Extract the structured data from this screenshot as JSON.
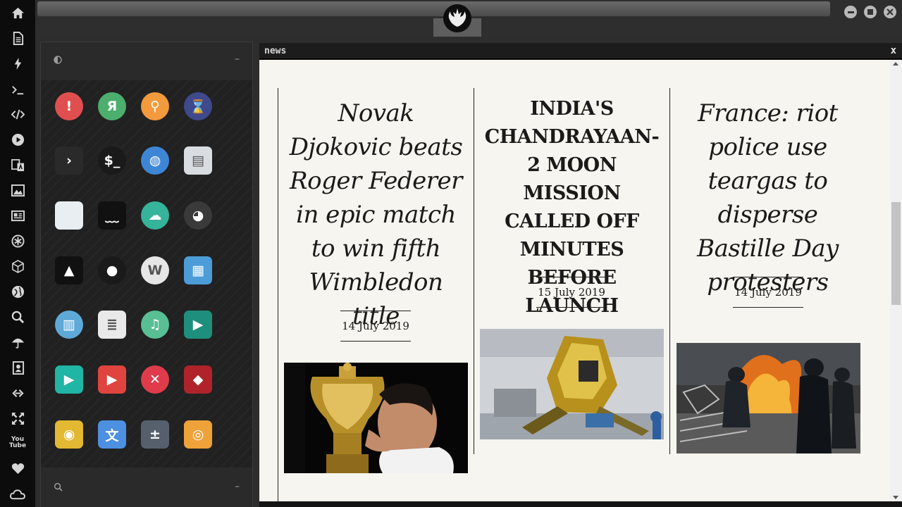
{
  "window": {
    "title": "news",
    "close_label": "x"
  },
  "dock": {
    "items": [
      "home-icon",
      "document-icon",
      "bolt-icon",
      "terminal-icon",
      "code-icon",
      "play-icon",
      "translate-icon",
      "image-icon",
      "newspaper-icon",
      "asterisk-icon",
      "cube-icon",
      "globe-icon",
      "search-icon",
      "umbrella-icon",
      "contact-icon",
      "link-icon",
      "expand-icon",
      "youtube-icon",
      "heart-icon",
      "cloud-icon"
    ],
    "youtube_text": "You Tube"
  },
  "launcher": {
    "header_icon": "contrast-icon",
    "minimize_label": "–",
    "footer_icon": "search-icon",
    "apps": [
      {
        "name": "warning-app-icon",
        "glyph": "!",
        "bg": "#e04f4f"
      },
      {
        "name": "yandex-app-icon",
        "glyph": "Я",
        "bg": "#4caf6d"
      },
      {
        "name": "search-app-icon",
        "glyph": "⚲",
        "bg": "#f39a3c"
      },
      {
        "name": "hourglass-app-icon",
        "glyph": "⌛",
        "bg": "#3e4a8c"
      },
      {
        "name": "terminal-prompt-app-icon",
        "glyph": "›",
        "bg": "#2a2a2a"
      },
      {
        "name": "shell-app-icon",
        "glyph": "$_",
        "bg": "#1a1a1a"
      },
      {
        "name": "web-browser-app-icon",
        "glyph": "◍",
        "bg": "#3d86d6"
      },
      {
        "name": "file-cabinet-app-icon",
        "glyph": "▤",
        "bg": "#d9dde2"
      },
      {
        "name": "window-app-icon",
        "glyph": "",
        "bg": "#e8eef2"
      },
      {
        "name": "mustache-app-icon",
        "glyph": "﹏",
        "bg": "#111111"
      },
      {
        "name": "cloud-lock-app-icon",
        "glyph": "☁",
        "bg": "#36b39b"
      },
      {
        "name": "github-app-icon",
        "glyph": "◕",
        "bg": "#3a3a3a"
      },
      {
        "name": "starfleet-app-icon",
        "glyph": "▲",
        "bg": "#111111"
      },
      {
        "name": "death-star-app-icon",
        "glyph": "●",
        "bg": "#1a1a1a"
      },
      {
        "name": "wikipedia-app-icon",
        "glyph": "W",
        "bg": "#e6e6e6"
      },
      {
        "name": "world-map-app-icon",
        "glyph": "▦",
        "bg": "#4c9cd8"
      },
      {
        "name": "library-app-icon",
        "glyph": "▥",
        "bg": "#5fa9d9"
      },
      {
        "name": "notebook-app-icon",
        "glyph": "≣",
        "bg": "#e9e9e9"
      },
      {
        "name": "music-app-icon",
        "glyph": "♫",
        "bg": "#58bf94"
      },
      {
        "name": "video-app-icon",
        "glyph": "▶",
        "bg": "#1e8f7c"
      },
      {
        "name": "media-player-app-icon",
        "glyph": "▶",
        "bg": "#20b5a4"
      },
      {
        "name": "youtube-app-icon",
        "glyph": "▶",
        "bg": "#e0443f"
      },
      {
        "name": "close-app-icon",
        "glyph": "✕",
        "bg": "#e03b4b"
      },
      {
        "name": "iron-man-app-icon",
        "glyph": "◆",
        "bg": "#b0232a"
      },
      {
        "name": "c3po-app-icon",
        "glyph": "◉",
        "bg": "#e3b832"
      },
      {
        "name": "translate-app-icon",
        "glyph": "文",
        "bg": "#4d8fe0"
      },
      {
        "name": "calculator-app-icon",
        "glyph": "±",
        "bg": "#56606c"
      },
      {
        "name": "camera-app-icon",
        "glyph": "◎",
        "bg": "#f0a23a"
      }
    ]
  },
  "articles": [
    {
      "headline": "Novak Djokovic beats Roger Federer in epic match to win fifth Wimbledon title",
      "date": "14 July 2019",
      "image": "tennis-trophy-photo"
    },
    {
      "headline": "India's Chandrayaan-2 moon mission called off minutes before launch",
      "date": "15 July 2019",
      "image": "lunar-lander-photo"
    },
    {
      "headline": "France: riot police use teargas to disperse Bastille Day protesters",
      "date": "14 July 2019",
      "image": "riot-police-fire-photo"
    }
  ]
}
